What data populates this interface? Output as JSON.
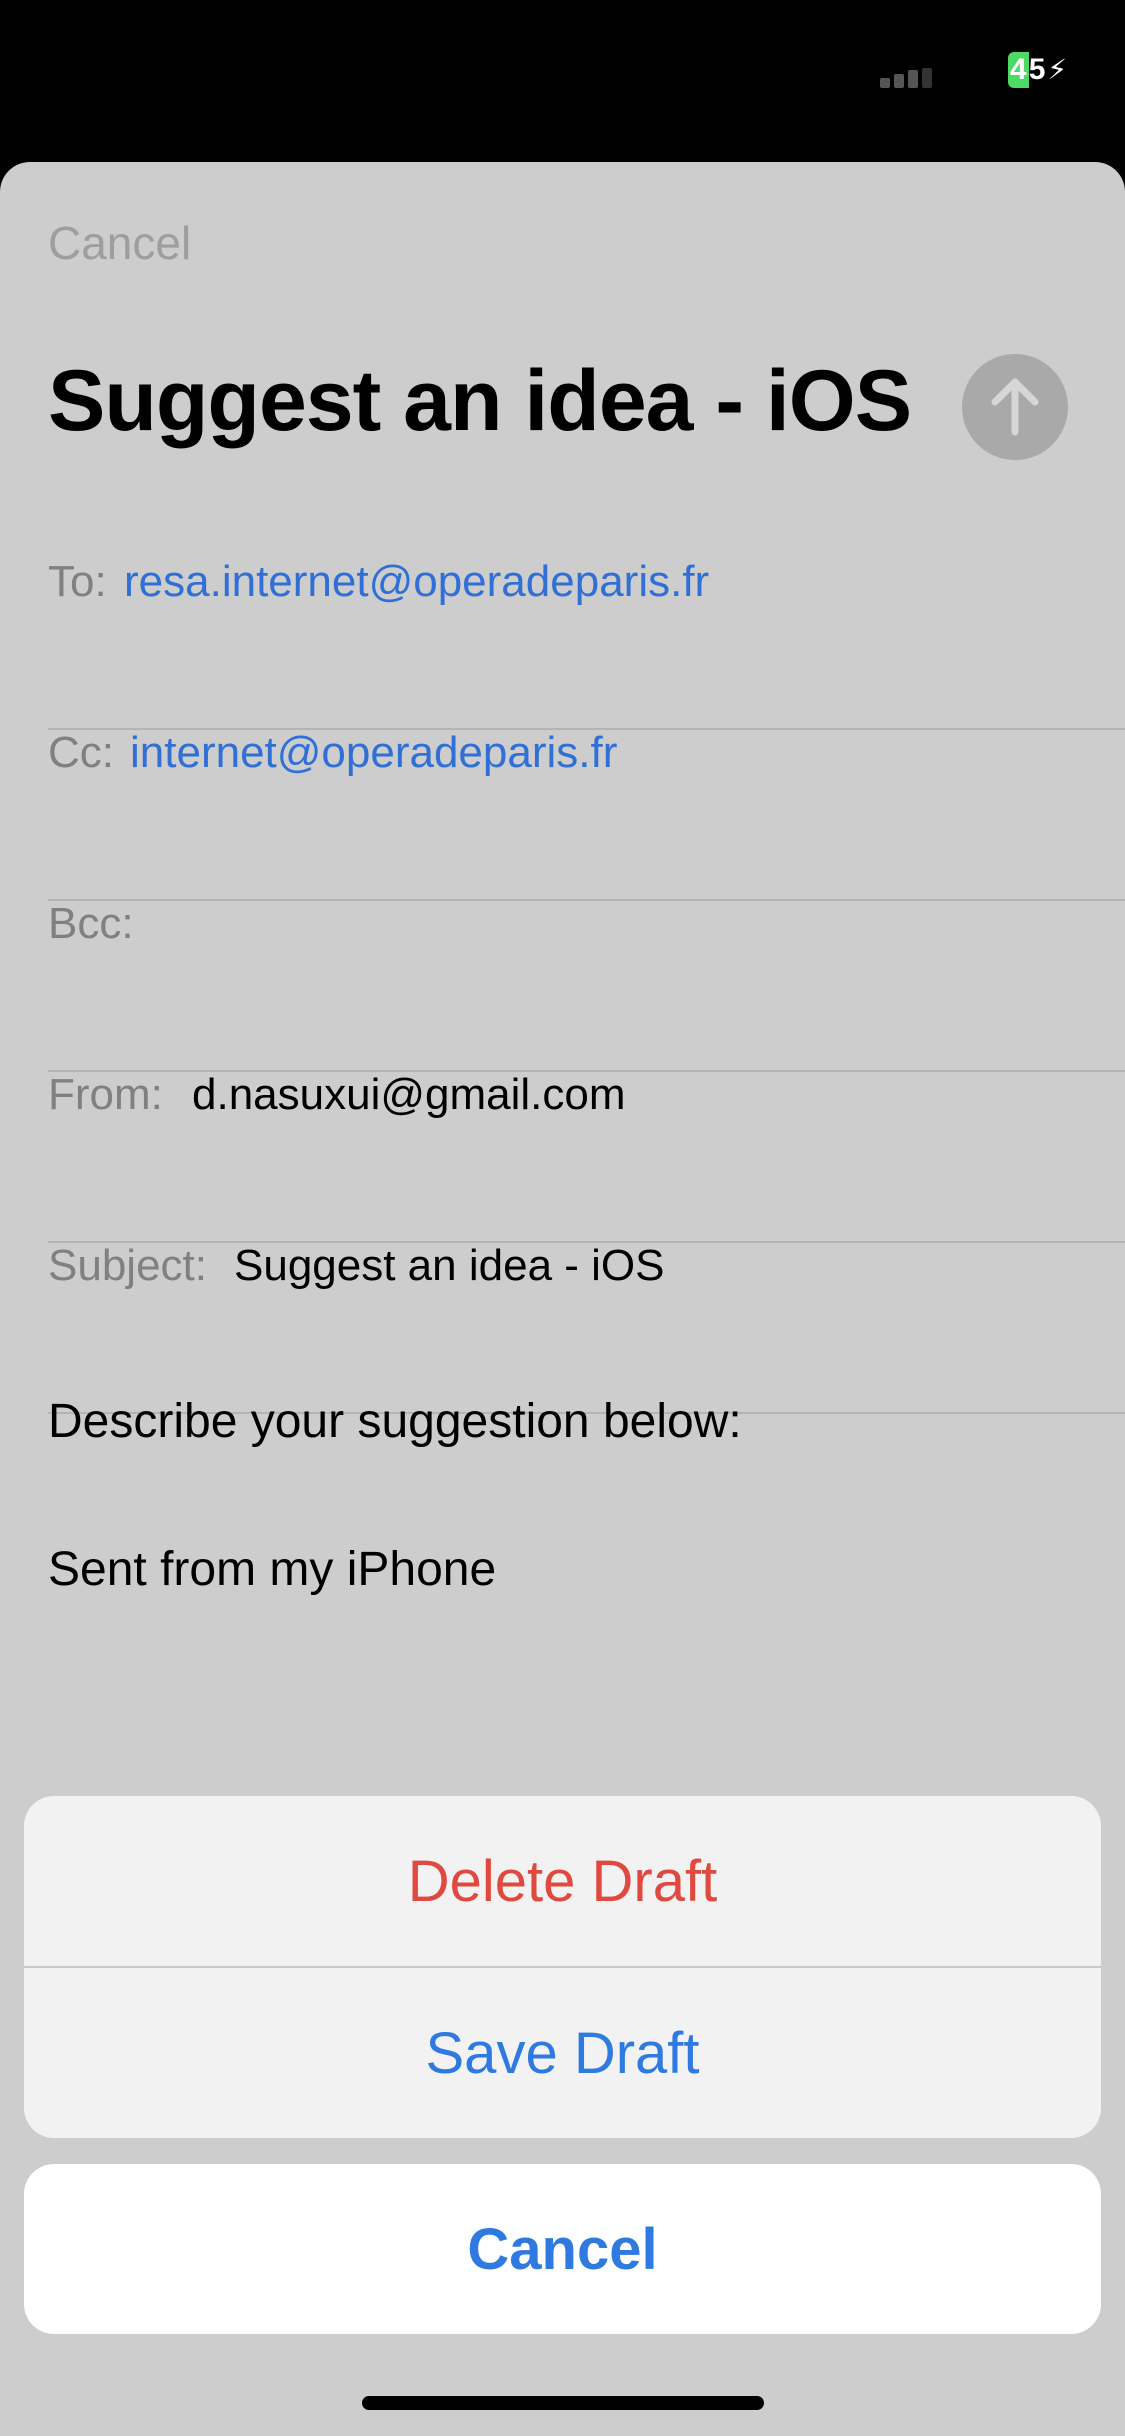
{
  "status_bar": {
    "battery_level": "45",
    "battery_fill_digit": "4",
    "battery_rest_digit": "5",
    "charging_icon": "bolt-icon",
    "signal_icon": "cellular-signal-icon"
  },
  "compose": {
    "cancel_label": "Cancel",
    "title": "Suggest an idea - iOS",
    "send_icon": "arrow-up-icon",
    "fields": {
      "to": {
        "label": "To:",
        "value": "resa.internet@operadeparis.fr"
      },
      "cc": {
        "label": "Cc:",
        "value": "internet@operadeparis.fr"
      },
      "bcc": {
        "label": "Bcc:",
        "value": ""
      },
      "from": {
        "label": "From:",
        "value": "d.nasuxui@gmail.com"
      },
      "subject": {
        "label": "Subject:",
        "value": "Suggest an idea - iOS"
      }
    },
    "body": {
      "line1": "Describe your suggestion below:",
      "signature": "Sent from my iPhone"
    }
  },
  "action_sheet": {
    "delete_label": "Delete Draft",
    "save_label": "Save Draft",
    "cancel_label": "Cancel"
  },
  "colors": {
    "link": "#2f6fd6",
    "destructive": "#e0493f",
    "action": "#2f7ae0",
    "sheet_background": "#cdcdcd",
    "battery": "#4cd964"
  }
}
